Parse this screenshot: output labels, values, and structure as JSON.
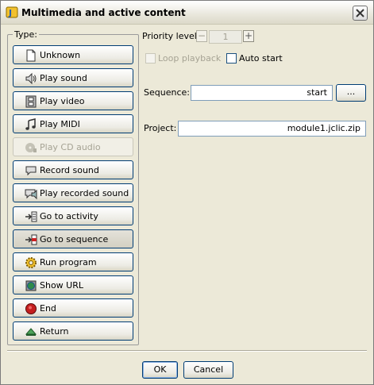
{
  "window": {
    "title": "Multimedia and active content"
  },
  "type_panel": {
    "legend": "Type:",
    "items": [
      {
        "label": "Unknown",
        "icon": "document-icon",
        "state": "normal"
      },
      {
        "label": "Play sound",
        "icon": "speaker-icon",
        "state": "normal"
      },
      {
        "label": "Play video",
        "icon": "film-icon",
        "state": "normal"
      },
      {
        "label": "Play MIDI",
        "icon": "music-note-icon",
        "state": "normal"
      },
      {
        "label": "Play CD audio",
        "icon": "cd-audio-icon",
        "state": "disabled"
      },
      {
        "label": "Record sound",
        "icon": "speech-bubble-icon",
        "state": "normal"
      },
      {
        "label": "Play recorded sound",
        "icon": "recorded-sound-icon",
        "state": "normal"
      },
      {
        "label": "Go to activity",
        "icon": "goto-activity-icon",
        "state": "normal"
      },
      {
        "label": "Go to sequence",
        "icon": "goto-sequence-icon",
        "state": "selected"
      },
      {
        "label": "Run program",
        "icon": "gear-icon",
        "state": "normal"
      },
      {
        "label": "Show URL",
        "icon": "globe-icon",
        "state": "normal"
      },
      {
        "label": "End",
        "icon": "stop-icon",
        "state": "normal"
      },
      {
        "label": "Return",
        "icon": "return-arrow-icon",
        "state": "normal"
      }
    ]
  },
  "options": {
    "priority_label": "Priority level:",
    "priority_minus": "−",
    "priority_value": "1",
    "priority_plus": "+",
    "loop_label": "Loop playback",
    "loop_checked": false,
    "autostart_label": "Auto start",
    "autostart_checked": false
  },
  "sequence": {
    "label": "Sequence:",
    "value": "start",
    "browse_label": "..."
  },
  "project": {
    "label": "Project:",
    "value": "module1.jclic.zip"
  },
  "buttons": {
    "ok": "OK",
    "cancel": "Cancel"
  },
  "colors": {
    "border_blue": "#003c74",
    "window_bg": "#ece9d8",
    "selected_icon_red": "#cc2222"
  }
}
